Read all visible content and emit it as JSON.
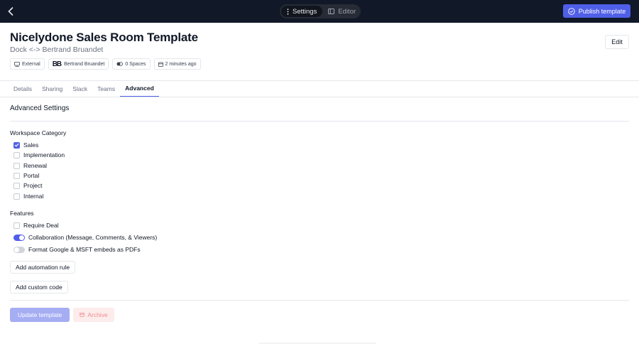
{
  "topbar": {
    "tabs": [
      {
        "label": "Settings",
        "icon": "more-vertical-icon",
        "active": true
      },
      {
        "label": "Editor",
        "icon": "layout-icon",
        "active": false
      }
    ],
    "publish_label": "Publish template",
    "accent": "#4f5fe8"
  },
  "header": {
    "title": "Nicelydone Sales Room Template",
    "subtitle": "Dock <-> Bertrand Bruandet",
    "edit_label": "Edit",
    "chips": {
      "visibility": "External",
      "owner_initials": "BB",
      "owner_name": "Bertrand Bruandet",
      "spaces": "0 Spaces",
      "updated": "2 minutes ago"
    }
  },
  "tabs": [
    {
      "label": "Details",
      "active": false
    },
    {
      "label": "Sharing",
      "active": false
    },
    {
      "label": "Slack",
      "active": false
    },
    {
      "label": "Teams",
      "active": false
    },
    {
      "label": "Advanced",
      "active": true
    }
  ],
  "advanced": {
    "title": "Advanced Settings",
    "workspace_category": {
      "label": "Workspace Category",
      "options": [
        {
          "label": "Sales",
          "checked": true
        },
        {
          "label": "Implementation",
          "checked": false
        },
        {
          "label": "Renewal",
          "checked": false
        },
        {
          "label": "Portal",
          "checked": false
        },
        {
          "label": "Project",
          "checked": false
        },
        {
          "label": "Internal",
          "checked": false
        }
      ]
    },
    "features": {
      "label": "Features",
      "require_deal": {
        "label": "Require Deal",
        "checked": false
      },
      "toggles": [
        {
          "label": "Collaboration (Message, Comments, & Viewers)",
          "on": true
        },
        {
          "label": "Format Google & MSFT embeds as PDFs",
          "on": false
        }
      ]
    },
    "add_automation_label": "Add automation rule",
    "add_custom_code_label": "Add custom code"
  },
  "footer": {
    "update_label": "Update template",
    "archive_label": "Archive"
  }
}
